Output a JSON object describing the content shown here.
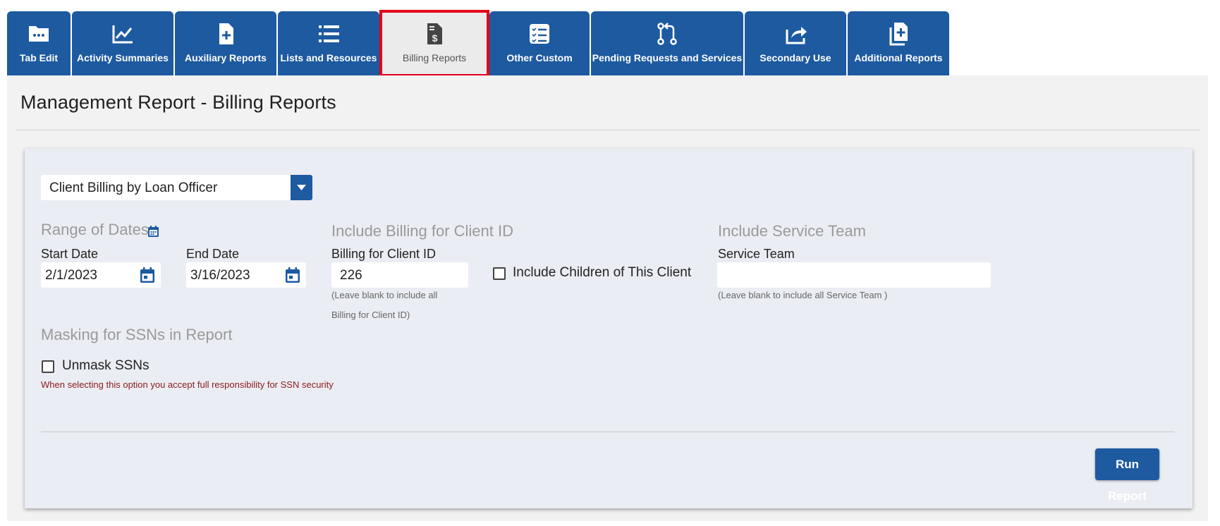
{
  "tabs": [
    {
      "label": "Tab Edit",
      "icon": "folder-icon"
    },
    {
      "label": "Activity Summaries",
      "icon": "line-chart-icon"
    },
    {
      "label": "Auxiliary Reports",
      "icon": "file-plus-icon"
    },
    {
      "label": "Lists and Resources",
      "icon": "list-icon"
    },
    {
      "label": "Billing Reports",
      "icon": "file-dollar-icon",
      "active": true
    },
    {
      "label": "Other Custom",
      "icon": "checklist-icon"
    },
    {
      "label": "Pending Requests and Services",
      "icon": "pull-request-icon"
    },
    {
      "label": "Secondary Use",
      "icon": "share-icon"
    },
    {
      "label": "Additional Reports",
      "icon": "copy-plus-icon"
    }
  ],
  "page": {
    "title": "Management Report - Billing Reports"
  },
  "report_select": {
    "value": "Client Billing by Loan Officer"
  },
  "range_of_dates": {
    "heading": "Range of Dates",
    "start_label": "Start Date",
    "start_value": "2/1/2023",
    "end_label": "End Date",
    "end_value": "3/16/2023"
  },
  "client": {
    "heading": "Include Billing for Client ID",
    "field_label": "Billing for Client ID",
    "field_value": "226",
    "hint_line1": "(Leave blank to include all",
    "hint_line2": "Billing for Client ID)",
    "children_label": "Include Children of This Client"
  },
  "service_team": {
    "heading": "Include Service Team",
    "field_label": "Service Team",
    "field_value": "",
    "hint": "(Leave blank to include all Service Team )"
  },
  "masking": {
    "heading": "Masking for SSNs in Report",
    "unmask_label": "Unmask SSNs",
    "warning": "When selecting this option you accept full responsibility for SSN security"
  },
  "actions": {
    "run_label": "Run Report"
  },
  "colors": {
    "primary": "#1d5aa0",
    "active_outline": "#e3001b",
    "warning_text": "#8b1a1a"
  }
}
